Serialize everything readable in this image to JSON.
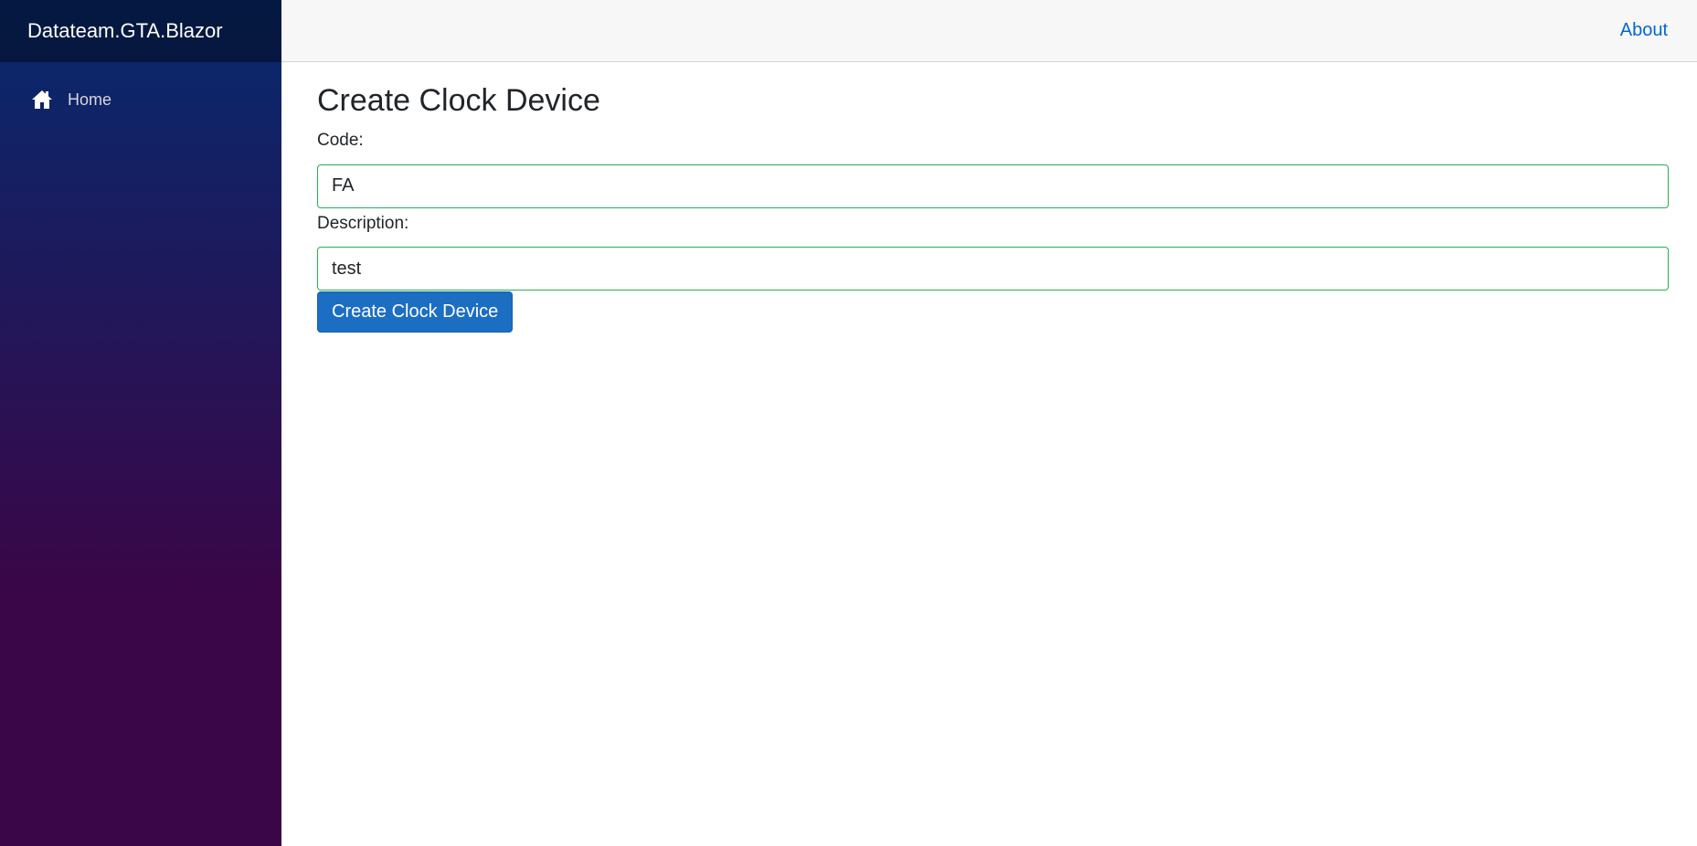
{
  "app": {
    "brand": "Datateam.GTA.Blazor"
  },
  "sidebar": {
    "items": [
      {
        "label": "Home",
        "icon": "home-icon"
      }
    ]
  },
  "top_row": {
    "about_link": "About"
  },
  "page": {
    "title": "Create Clock Device",
    "form": {
      "code_label": "Code:",
      "code_value": "FA",
      "description_label": "Description:",
      "description_value": "test",
      "submit_label": "Create Clock Device"
    }
  },
  "colors": {
    "sidebar_gradient_top": "#062a6e",
    "sidebar_gradient_bottom": "#3a0647",
    "link": "#0366d6",
    "button": "#1b6ec2",
    "valid_border": "#26b050"
  }
}
